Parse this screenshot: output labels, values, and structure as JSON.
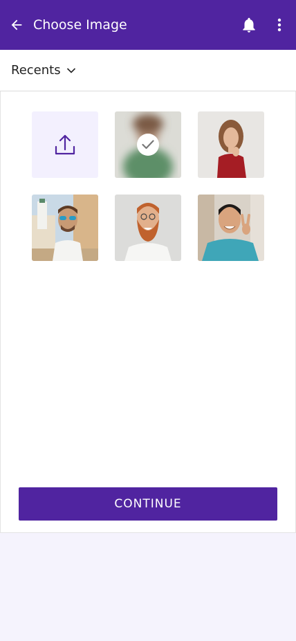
{
  "appbar": {
    "title": "Choose Image",
    "back_icon": "arrow-left-icon",
    "bell_icon": "bell-icon",
    "more_icon": "more-vertical-icon"
  },
  "album": {
    "selected": "Recents"
  },
  "grid": {
    "upload_icon": "upload-icon",
    "selected_index": 0,
    "photos": [
      {
        "selected": true
      },
      {
        "selected": false
      },
      {
        "selected": false
      },
      {
        "selected": false
      },
      {
        "selected": false
      }
    ]
  },
  "footer": {
    "continue_label": "CONTINUE"
  },
  "colors": {
    "primary": "#5024a0",
    "upload_bg": "#f3f0fe",
    "page_bg": "#f5f3fd"
  }
}
